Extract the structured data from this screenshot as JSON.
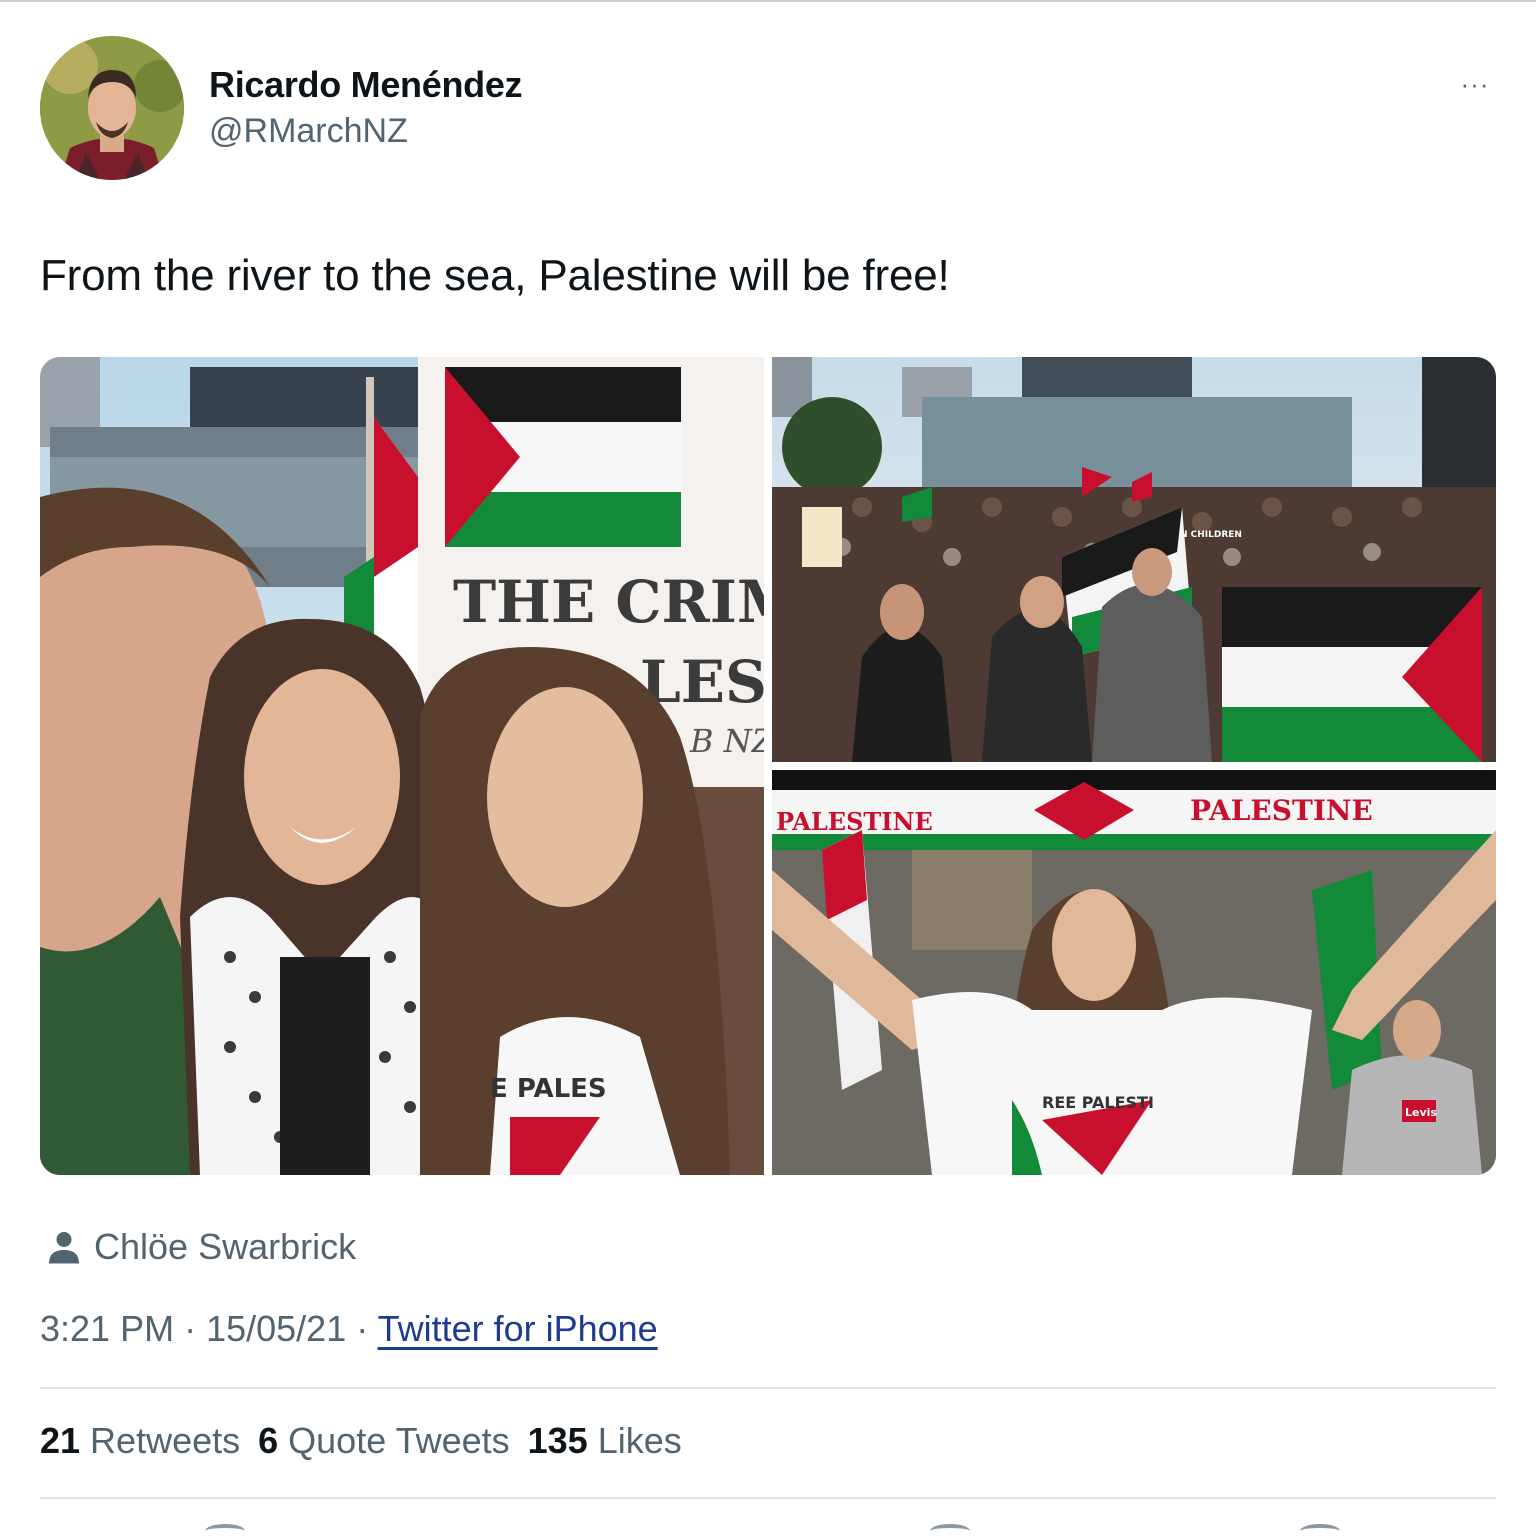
{
  "author": {
    "display_name": "Ricardo Menéndez",
    "handle": "@RMarchNZ"
  },
  "more_label": "···",
  "tweet": {
    "text": "From the river to the sea, Palestine will be free!"
  },
  "media": [
    {
      "banner_line1": "THE CRIM",
      "banner_line2": "LES",
      "banner_line3": "B NZ",
      "shirt_text": "E PALES"
    },
    {
      "sign_text": "N CHILDREN"
    },
    {
      "scarf_left": "PALESTINE",
      "scarf_right": "PALESTINE",
      "shirt_text": "REE PALESTI",
      "hoodie_logo": "Levis"
    }
  ],
  "tagged_user": "Chlöe Swarbrick",
  "meta": {
    "time": "3:21 PM",
    "separator": " · ",
    "date": "15/05/21",
    "source": "Twitter for iPhone"
  },
  "stats": {
    "retweets": {
      "count": "21",
      "label": "Retweets"
    },
    "quotes": {
      "count": "6",
      "label": "Quote Tweets"
    },
    "likes": {
      "count": "135",
      "label": "Likes"
    }
  },
  "colors": {
    "text": "#0f1419",
    "secondary": "#536471",
    "link": "#1d3c8f",
    "flag_red": "#c8102e",
    "flag_green": "#128a3a",
    "flag_black": "#1a1a1a"
  }
}
